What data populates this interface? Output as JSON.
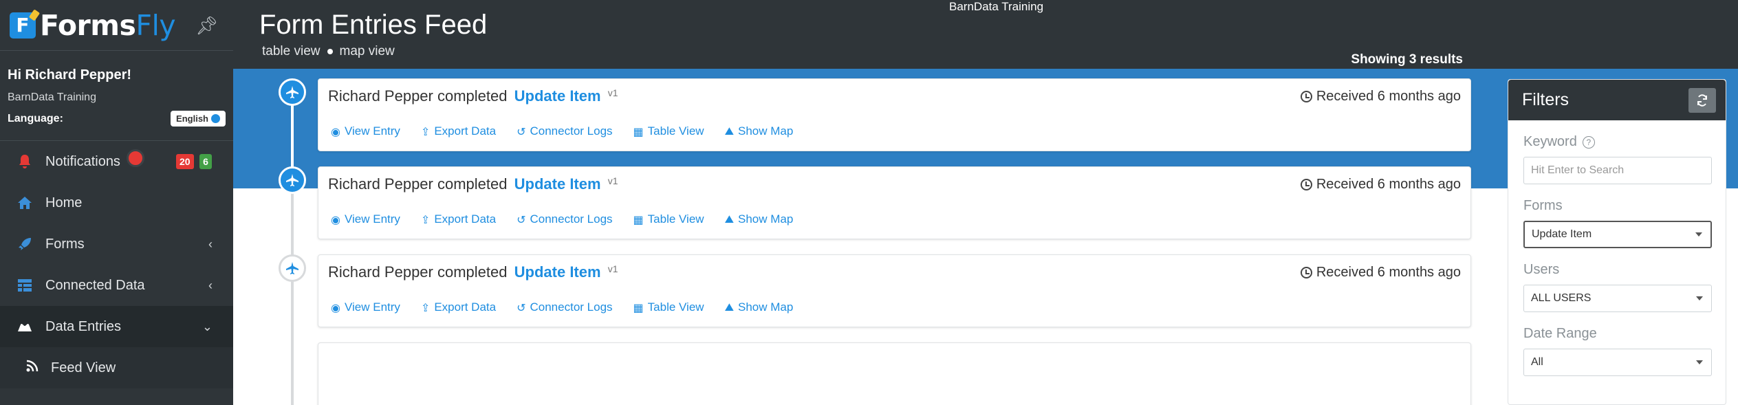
{
  "org_name": "BarnData Training",
  "sidebar": {
    "logo": {
      "part1": "Forms",
      "part2": "Fly",
      "mark": "F"
    },
    "greeting": "Hi Richard Pepper!",
    "org": "BarnData Training",
    "language_label": "Language:",
    "language_value": "English",
    "items": [
      {
        "label": "Notifications",
        "icon": "bell-icon",
        "badge_red": "20",
        "badge_green": "6"
      },
      {
        "label": "Home",
        "icon": "home-icon"
      },
      {
        "label": "Forms",
        "icon": "rocket-icon",
        "chevron": "‹"
      },
      {
        "label": "Connected Data",
        "icon": "table-icon",
        "chevron": "‹"
      },
      {
        "label": "Data Entries",
        "icon": "inbox-icon",
        "chevron": "⌄"
      },
      {
        "label": "Feed View",
        "icon": "rss-icon"
      }
    ]
  },
  "header": {
    "title": "Form Entries Feed",
    "links": [
      "table view",
      "map view"
    ],
    "showing": "Showing 3 results"
  },
  "entries": [
    {
      "user": "Richard Pepper",
      "verb": "completed",
      "form": "Update Item",
      "version": "v1",
      "received": "Received 6 months ago"
    },
    {
      "user": "Richard Pepper",
      "verb": "completed",
      "form": "Update Item",
      "version": "v1",
      "received": "Received 6 months ago"
    },
    {
      "user": "Richard Pepper",
      "verb": "completed",
      "form": "Update Item",
      "version": "v1",
      "received": "Received 6 months ago"
    }
  ],
  "actions": [
    "View Entry",
    "Export Data",
    "Connector Logs",
    "Table View",
    "Show Map"
  ],
  "filters": {
    "title": "Filters",
    "keyword_label": "Keyword",
    "keyword_placeholder": "Hit Enter to Search",
    "forms_label": "Forms",
    "forms_value": "Update Item",
    "users_label": "Users",
    "users_value": "ALL USERS",
    "date_label": "Date Range",
    "date_value": "All"
  },
  "colors": {
    "accent": "#1f8ee0",
    "band": "#2d7fc3",
    "sidebar": "#2f3539",
    "badge_red": "#e53935",
    "badge_green": "#43a047"
  }
}
